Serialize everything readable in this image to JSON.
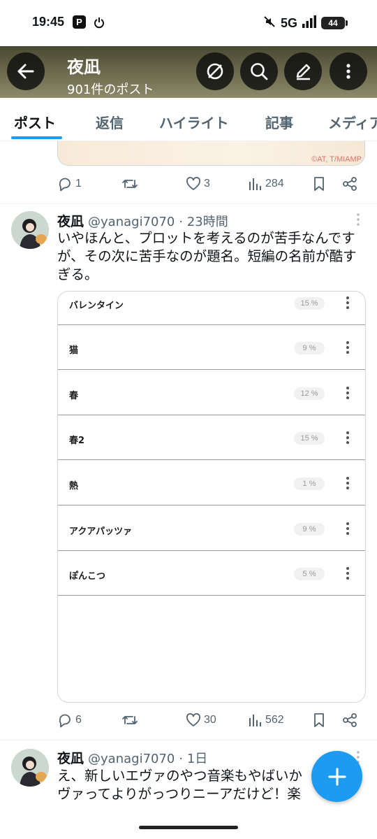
{
  "status_bar": {
    "time": "19:45",
    "app_badge": "P",
    "network": "5G",
    "battery": "44"
  },
  "header": {
    "title": "夜凪",
    "post_count": "901件のポスト"
  },
  "tabs": [
    {
      "label": "ポスト",
      "active": true
    },
    {
      "label": "返信"
    },
    {
      "label": "ハイライト"
    },
    {
      "label": "記事"
    },
    {
      "label": "メディア"
    }
  ],
  "prev_post": {
    "card_credit": "©AT, T/MIAMP",
    "replies": "1",
    "reposts": "",
    "likes": "3",
    "views": "284"
  },
  "post1": {
    "name": "夜凪",
    "handle": "@yanagi7070",
    "time": "· 23時間",
    "text": "いやほんと、プロットを考えるのが苦手なんですが、その次に苦手なのが題名。短編の名前が酷すぎる。",
    "items": [
      {
        "label": "バレンタイン",
        "pct": "15 %"
      },
      {
        "label": "猫",
        "pct": "9 %"
      },
      {
        "label": "春",
        "pct": "12 %"
      },
      {
        "label": "春2",
        "pct": "15 %"
      },
      {
        "label": "熱",
        "pct": "1 %"
      },
      {
        "label": "アクアパッツァ",
        "pct": "9 %"
      },
      {
        "label": "ぽんこつ",
        "pct": "5 %"
      }
    ],
    "replies": "6",
    "likes": "30",
    "views": "562"
  },
  "post2": {
    "name": "夜凪",
    "handle": "@yanagi7070",
    "time": "· 1日",
    "text_line1": "え、新しいエヴァのやつ音楽もやばいか",
    "text_line2": "ヴァってよりがっつりニーアだけど！楽"
  },
  "colors": {
    "accent": "#1d9bf0",
    "text": "#0f1419",
    "muted": "#536471"
  }
}
